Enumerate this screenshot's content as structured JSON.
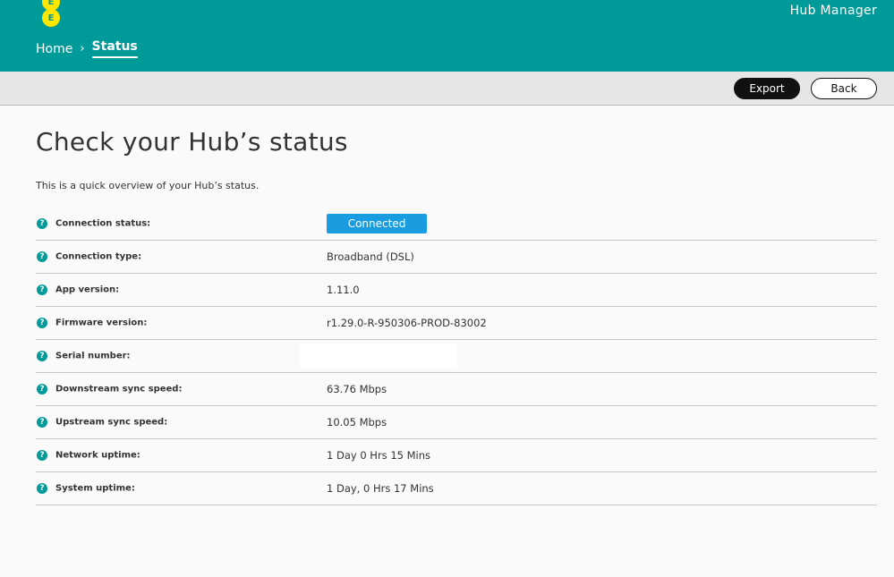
{
  "header": {
    "logo_letters": [
      "E",
      "E"
    ],
    "app_title": "Hub Manager",
    "breadcrumb": {
      "home": "Home",
      "separator": "›",
      "current": "Status"
    }
  },
  "toolbar": {
    "export_label": "Export",
    "back_label": "Back"
  },
  "main": {
    "title": "Check your Hub’s status",
    "intro": "This is a quick overview of your Hub’s status.",
    "help_glyph": "?",
    "rows": [
      {
        "label": "Connection status:",
        "value": "Connected"
      },
      {
        "label": "Connection type:",
        "value": "Broadband (DSL)"
      },
      {
        "label": "App version:",
        "value": "1.11.0"
      },
      {
        "label": "Firmware version:",
        "value": "r1.29.0-R-950306-PROD-83002"
      },
      {
        "label": "Serial number:",
        "value": ""
      },
      {
        "label": "Downstream sync speed:",
        "value": "63.76 Mbps"
      },
      {
        "label": "Upstream sync speed:",
        "value": "10.05 Mbps"
      },
      {
        "label": "Network uptime:",
        "value": "1 Day 0 Hrs 15 Mins"
      },
      {
        "label": "System uptime:",
        "value": "1 Day, 0 Hrs 17 Mins"
      }
    ]
  },
  "colors": {
    "brand_teal": "#009b98",
    "logo_yellow": "#ffe700",
    "connected_blue": "#1a9de0"
  }
}
